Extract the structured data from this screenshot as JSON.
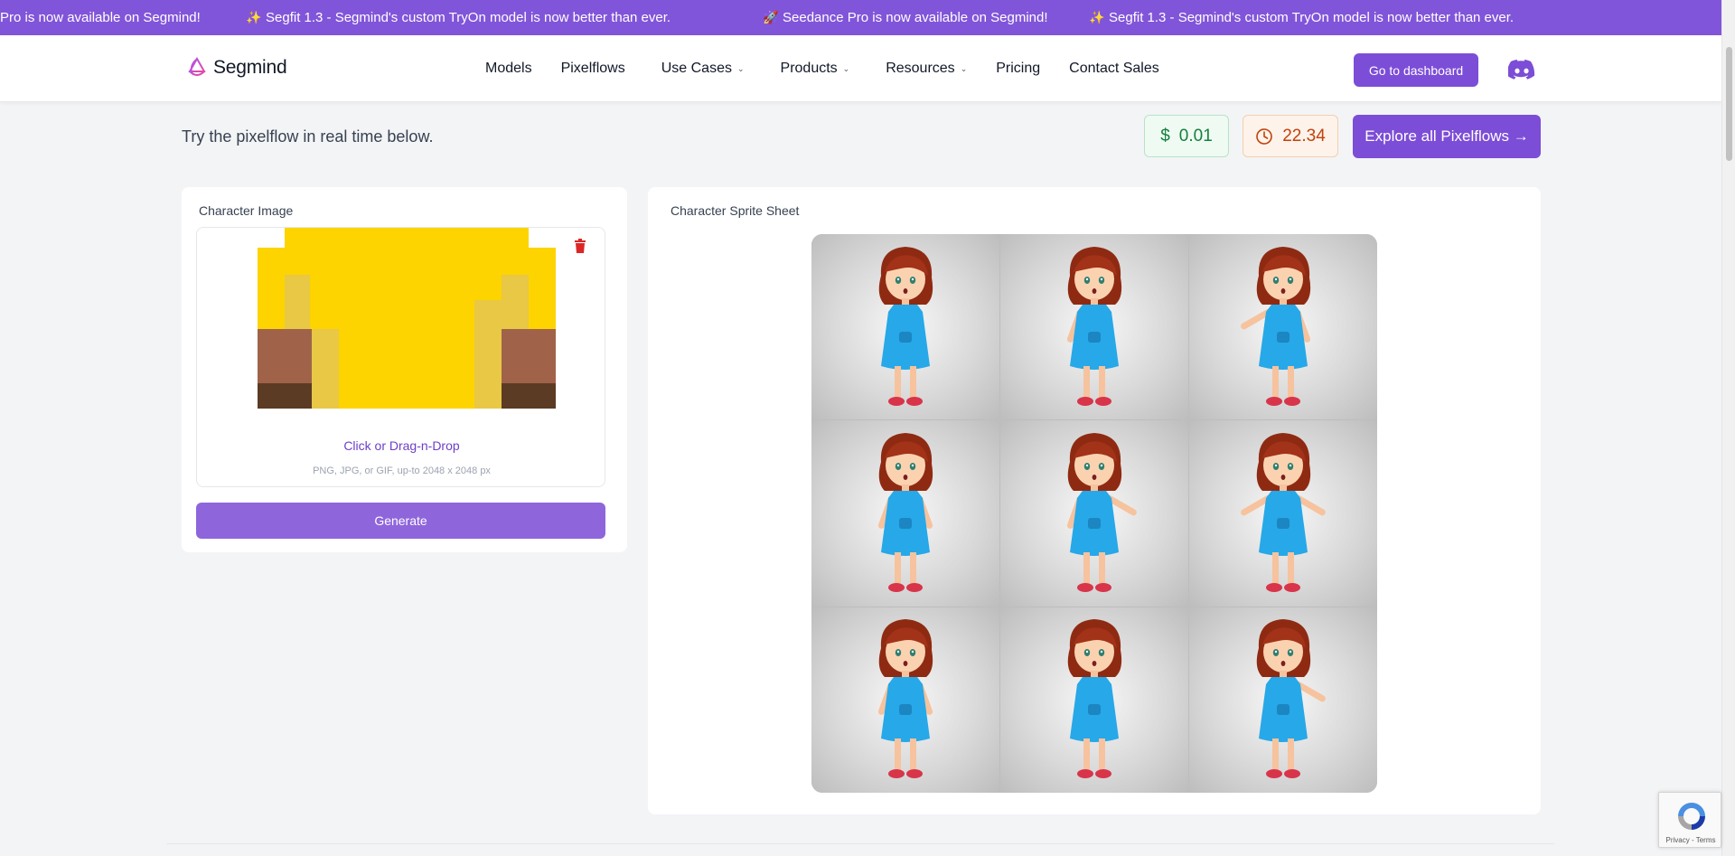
{
  "announcements": [
    {
      "icon": "none",
      "text": "Pro is now available on Segmind!"
    },
    {
      "icon": "sparkle-icon",
      "text": "Segfit 1.3 - Segmind's custom TryOn model is now better than ever."
    },
    {
      "icon": "rocket-icon",
      "text": "Seedance Pro is now available on Segmind!"
    },
    {
      "icon": "sparkle-icon",
      "text": "Segfit 1.3 - Segmind's custom TryOn model is now better than ever."
    }
  ],
  "nav": {
    "brand": "Segmind",
    "items": [
      {
        "label": "Models",
        "dropdown": false
      },
      {
        "label": "Pixelflows",
        "dropdown": false
      },
      {
        "label": "Use Cases",
        "dropdown": true
      },
      {
        "label": "Products",
        "dropdown": true
      },
      {
        "label": "Resources",
        "dropdown": true
      },
      {
        "label": "Pricing",
        "dropdown": false
      },
      {
        "label": "Contact Sales",
        "dropdown": false
      }
    ],
    "dashboard_label": "Go to dashboard"
  },
  "header": {
    "subtitle": "Try the pixelflow in real time below.",
    "cost_symbol": "$",
    "cost": "0.01",
    "time": "22.34",
    "explore_label": "Explore all Pixelflows →"
  },
  "input": {
    "label": "Character Image",
    "dropzone_link": "Click or Drag-n-Drop",
    "dropzone_help": "PNG, JPG, or GIF, up-to 2048 x 2048 px",
    "generate_label": "Generate"
  },
  "output": {
    "label": "Character Sprite Sheet",
    "frames": 9
  },
  "recaptcha": {
    "text": "Privacy - Terms"
  },
  "colors": {
    "brand": "#7c4dd6",
    "announce_bg": "#8155d9",
    "cost_green": "#16803c",
    "time_orange": "#c2410c",
    "trash_red": "#dc2626"
  }
}
